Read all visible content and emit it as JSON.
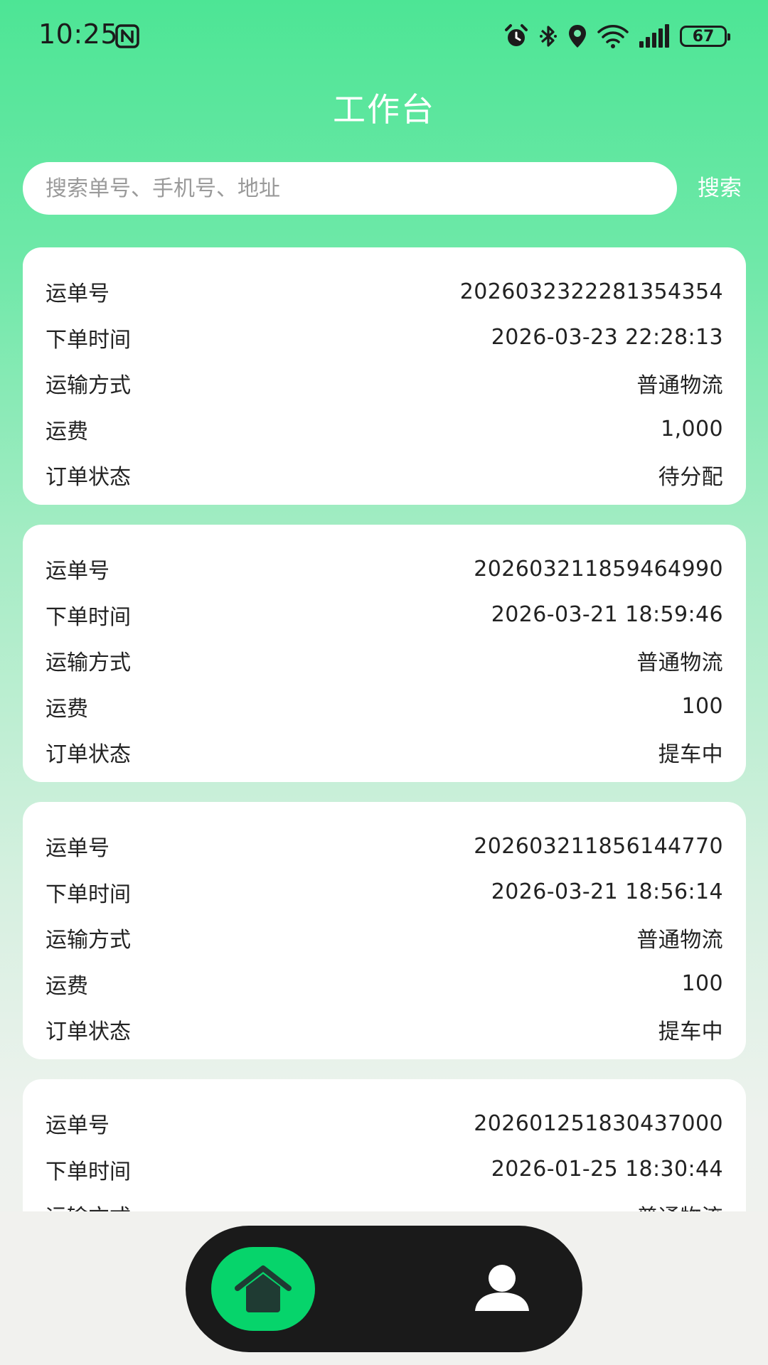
{
  "status_bar": {
    "time": "10:25",
    "battery": "67",
    "icons": [
      "nfc-icon",
      "alarm-icon",
      "bluetooth-icon",
      "location-icon",
      "wifi-icon",
      "signal-icon",
      "battery-icon"
    ]
  },
  "header": {
    "title": "工作台"
  },
  "search": {
    "placeholder": "搜索单号、手机号、地址",
    "value": "",
    "button_label": "搜索"
  },
  "orders": [
    {
      "fields": [
        {
          "label": "运单号",
          "value": "2026032322281354354"
        },
        {
          "label": "下单时间",
          "value": "2026-03-23 22:28:13"
        },
        {
          "label": "运输方式",
          "value": "普通物流"
        },
        {
          "label": "运费",
          "value": "1,000"
        },
        {
          "label": "订单状态",
          "value": "待分配"
        }
      ]
    },
    {
      "fields": [
        {
          "label": "运单号",
          "value": "202603211859464990"
        },
        {
          "label": "下单时间",
          "value": "2026-03-21 18:59:46"
        },
        {
          "label": "运输方式",
          "value": "普通物流"
        },
        {
          "label": "运费",
          "value": "100"
        },
        {
          "label": "订单状态",
          "value": "提车中"
        }
      ]
    },
    {
      "fields": [
        {
          "label": "运单号",
          "value": "202603211856144770"
        },
        {
          "label": "下单时间",
          "value": "2026-03-21 18:56:14"
        },
        {
          "label": "运输方式",
          "value": "普通物流"
        },
        {
          "label": "运费",
          "value": "100"
        },
        {
          "label": "订单状态",
          "value": "提车中"
        }
      ]
    },
    {
      "fields": [
        {
          "label": "运单号",
          "value": "202601251830437000"
        },
        {
          "label": "下单时间",
          "value": "2026-01-25 18:30:44"
        },
        {
          "label": "运输方式",
          "value": "普通物流"
        }
      ]
    }
  ],
  "bottom_nav": {
    "items": [
      {
        "icon": "home-icon",
        "active": true
      },
      {
        "icon": "user-icon",
        "active": false
      }
    ]
  },
  "colors": {
    "accent": "#06d46b",
    "nav_background": "#1a1a1a",
    "gradient_top": "#4de595"
  }
}
